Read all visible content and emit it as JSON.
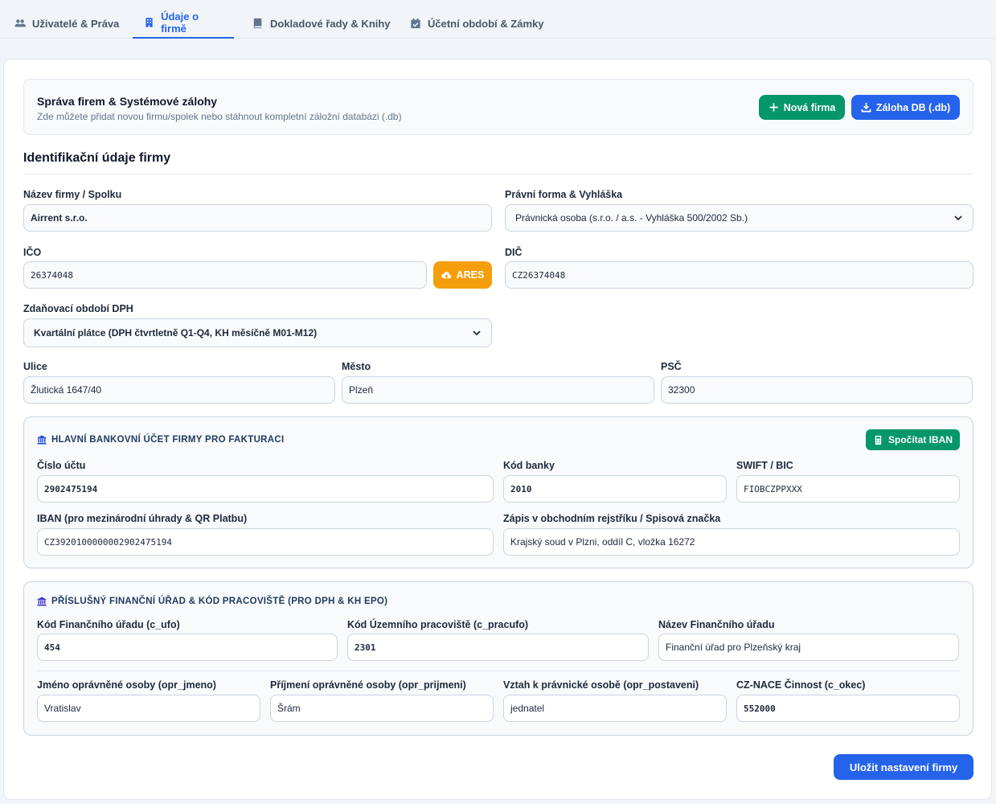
{
  "tabs": [
    {
      "label": "Uživatelé & Práva",
      "icon": "users-icon"
    },
    {
      "label": "Údaje o firmě",
      "icon": "building-icon"
    },
    {
      "label": "Dokladové řady & Knihy",
      "icon": "book-icon"
    },
    {
      "label": "Účetní období & Zámky",
      "icon": "calendar-check-icon"
    }
  ],
  "management": {
    "title": "Správa firem & Systémové zálohy",
    "subtitle": "Zde můžete přidat novou firmu/spolek nebo stáhnout kompletní záložní databázi (.db)",
    "new_company_label": "Nová firma",
    "backup_label": "Záloha DB (.db)"
  },
  "identification": {
    "title": "Identifikační údaje firmy",
    "name_label": "Název firmy / Spolku",
    "name_value": "Airrent s.r.o.",
    "legal_form_label": "Právní forma & Vyhláška",
    "legal_form_value": "Právnická osoba (s.r.o. / a.s. - Vyhláška 500/2002 Sb.)",
    "ico_label": "IČO",
    "ico_value": "26374048",
    "ares_label": "ARES",
    "dic_label": "DIČ",
    "dic_value": "CZ26374048",
    "vat_period_label": "Zdaňovací období DPH",
    "vat_period_value": "Kvartální plátce (DPH čtvrtletně Q1-Q4, KH měsíčně M01-M12)",
    "street_label": "Ulice",
    "street_value": "Žlutická 1647/40",
    "city_label": "Město",
    "city_value": "Plzeň",
    "zip_label": "PSČ",
    "zip_value": "32300"
  },
  "bank": {
    "title": "HLAVNÍ BANKOVNÍ ÚČET FIRMY PRO FAKTURACI",
    "iban_button_label": "Spočítat IBAN",
    "account_label": "Číslo účtu",
    "account_value": "2902475194",
    "bank_code_label": "Kód banky",
    "bank_code_value": "2010",
    "swift_label": "SWIFT / BIC",
    "swift_value": "FIOBCZPPXXX",
    "iban_label": "IBAN (pro mezinárodní úhrady & QR Platbu)",
    "iban_value": "CZ3920100000002902475194",
    "registry_label": "Zápis v obchodním rejstříku / Spisová značka",
    "registry_value": "Krajský soud v Plzni, oddíl C, vložka 16272"
  },
  "tax_office": {
    "title": "PŘÍSLUŠNÝ FINANČNÍ ÚŘAD & KÓD PRACOVIŠTĚ (PRO DPH & KH EPO)",
    "ufo_label": "Kód Finančního úřadu (c_ufo)",
    "ufo_value": "454",
    "pracufo_label": "Kód Územního pracoviště (c_pracufo)",
    "pracufo_value": "2301",
    "office_name_label": "Název Finančního úřadu",
    "office_name_value": "Finanční úřad pro Plzeňský kraj",
    "first_name_label": "Jméno oprávněné osoby (opr_jmeno)",
    "first_name_value": "Vratislav",
    "last_name_label": "Příjmení oprávněné osoby (opr_prijmeni)",
    "last_name_value": "Šrám",
    "relation_label": "Vztah k právnické osobě (opr_postaveni)",
    "relation_value": "jednatel",
    "nace_label": "CZ-NACE Činnost (c_okec)",
    "nace_value": "552000"
  },
  "save_label": "Uložit nastavení firmy",
  "colors": {
    "primary": "#2563eb",
    "success": "#059669",
    "warning": "#f59e0b"
  }
}
